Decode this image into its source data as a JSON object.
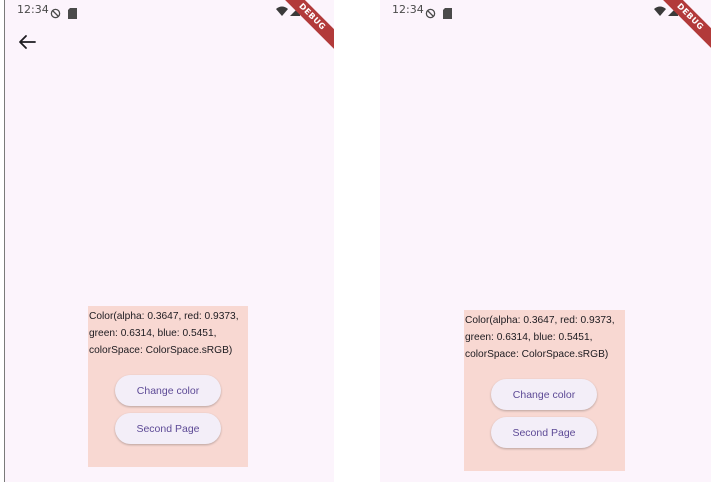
{
  "screens": [
    {
      "status_time": "12:34",
      "debug_label": "DEBUG",
      "show_back": true,
      "color_text": "Color(alpha: 0.3647, red: 0.9373, green: 0.6314, blue: 0.5451, colorSpace: ColorSpace.sRGB)",
      "change_color_label": "Change color",
      "second_page_label": "Second Page"
    },
    {
      "status_time": "12:34",
      "debug_label": "DEBUG",
      "show_back": false,
      "color_text": "Color(alpha: 0.3647, red: 0.9373, green: 0.6314, blue: 0.5451, colorSpace: ColorSpace.sRGB)",
      "change_color_label": "Change color",
      "second_page_label": "Second Page"
    }
  ],
  "icons": {
    "back": "arrow-back-icon",
    "dnd": "do-not-disturb-icon",
    "sd": "sd-card-icon",
    "wifi": "wifi-icon",
    "signal": "signal-icon",
    "battery": "battery-icon"
  },
  "colors": {
    "screen_bg": "#fcf4fc",
    "panel_bg": "#f8d8d2",
    "button_bg": "#f3eef8",
    "button_text": "#5d4a96",
    "debug_ribbon": "#b23a3a"
  }
}
